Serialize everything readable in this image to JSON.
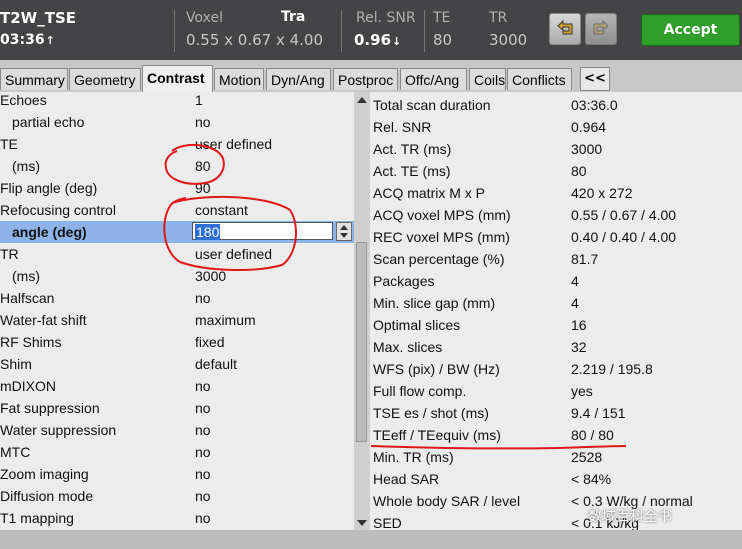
{
  "header": {
    "scan_name": "T2W_TSE",
    "scan_time": "03:36",
    "voxel_label": "Voxel",
    "voxel_value": "0.55 x 0.67 x 4.00",
    "tra_label": "Tra",
    "rel_snr_label": "Rel. SNR",
    "rel_snr_value": "0.96",
    "te_label": "TE",
    "te_value": "80",
    "tr_label": "TR",
    "tr_value": "3000",
    "accept_label": "Accept",
    "accept_color": "#2f9e2b"
  },
  "tabs": [
    {
      "label": "Summary"
    },
    {
      "label": "Geometry"
    },
    {
      "label": "Contrast"
    },
    {
      "label": "Motion"
    },
    {
      "label": "Dyn/Ang"
    },
    {
      "label": "Postproc"
    },
    {
      "label": "Offc/Ang"
    },
    {
      "label": "Coils"
    },
    {
      "label": "Conflicts"
    }
  ],
  "collapse_label": "<<",
  "params": [
    {
      "label": "Echoes",
      "value": "1"
    },
    {
      "label": "partial echo",
      "value": "no"
    },
    {
      "label": "TE",
      "value": "user defined"
    },
    {
      "label": "(ms)",
      "value": "80"
    },
    {
      "label": "Flip angle (deg)",
      "value": "90"
    },
    {
      "label": "Refocusing  control",
      "value": "constant"
    },
    {
      "label": "angle (deg)",
      "value": "180"
    },
    {
      "label": "TR",
      "value": "user defined"
    },
    {
      "label": "(ms)",
      "value": "3000"
    },
    {
      "label": "Halfscan",
      "value": "no"
    },
    {
      "label": "Water-fat shift",
      "value": "maximum"
    },
    {
      "label": "RF Shims",
      "value": "fixed"
    },
    {
      "label": "Shim",
      "value": "default"
    },
    {
      "label": "mDIXON",
      "value": "no"
    },
    {
      "label": "Fat suppression",
      "value": "no"
    },
    {
      "label": "Water  suppression",
      "value": "no"
    },
    {
      "label": "MTC",
      "value": "no"
    },
    {
      "label": "Zoom imaging",
      "value": "no"
    },
    {
      "label": "Diffusion mode",
      "value": "no"
    },
    {
      "label": "T1 mapping",
      "value": "no"
    }
  ],
  "info": [
    {
      "label": "Total  scan  duration",
      "value": "03:36.0"
    },
    {
      "label": "Rel. SNR",
      "value": "0.964"
    },
    {
      "label": "Act. TR (ms)",
      "value": "3000"
    },
    {
      "label": "Act. TE (ms)",
      "value": "80"
    },
    {
      "label": "ACQ matrix M x P",
      "value": "420 x 272"
    },
    {
      "label": "ACQ voxel MPS  (mm)",
      "value": "0.55 / 0.67 / 4.00"
    },
    {
      "label": "REC voxel MPS  (mm)",
      "value": "0.40 / 0.40 / 4.00"
    },
    {
      "label": "Scan  percentage  (%)",
      "value": "81.7"
    },
    {
      "label": "Packages",
      "value": "4"
    },
    {
      "label": "Min. slice gap  (mm)",
      "value": "4"
    },
    {
      "label": "Optimal slices",
      "value": "16"
    },
    {
      "label": "Max. slices",
      "value": "32"
    },
    {
      "label": "WFS (pix) / BW (Hz)",
      "value": "2.219 / 195.8"
    },
    {
      "label": "Full flow comp.",
      "value": "yes"
    },
    {
      "label": "TSE es / shot (ms)",
      "value": "9.4 / 151"
    },
    {
      "label": "TEeff / TEequiv  (ms)",
      "value": "80 / 80"
    },
    {
      "label": "Min. TR (ms)",
      "value": "2528"
    },
    {
      "label": "Head SAR",
      "value": "< 84%"
    },
    {
      "label": "Whole body SAR / level",
      "value": "< 0.3 W/kg / normal"
    },
    {
      "label": "SED",
      "value": "< 0.1 kJ/kg"
    }
  ],
  "watermark": "数域百科全书",
  "annotation_color": "#e01818",
  "selected_row_color": "#8db3e8"
}
